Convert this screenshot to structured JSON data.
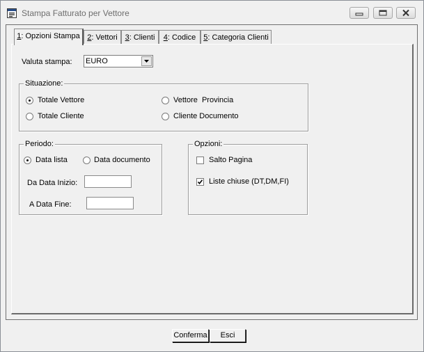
{
  "window": {
    "title": "Stampa Fatturato per Vettore",
    "icon": "form-window-icon",
    "controls": [
      "minimize-icon",
      "restore-icon",
      "close-icon"
    ]
  },
  "tabs": [
    {
      "mnemonic": "1",
      "label": ": Opzioni Stampa",
      "active": true
    },
    {
      "mnemonic": "2",
      "label": ": Vettori",
      "active": false
    },
    {
      "mnemonic": "3",
      "label": ": Clienti",
      "active": false
    },
    {
      "mnemonic": "4",
      "label": ": Codice",
      "active": false
    },
    {
      "mnemonic": "5",
      "label": ": Categoria Clienti",
      "active": false
    }
  ],
  "valuta": {
    "label": "Valuta stampa:",
    "value": "EURO"
  },
  "situazione": {
    "legend": "Situazione:",
    "options": [
      {
        "label": "Totale Vettore",
        "selected": true
      },
      {
        "label": "Totale Cliente",
        "selected": false
      },
      {
        "label": "Vettore  Provincia",
        "selected": false
      },
      {
        "label": "Cliente Documento",
        "selected": false
      }
    ]
  },
  "periodo": {
    "legend": "Periodo:",
    "options": [
      {
        "label": "Data lista",
        "selected": true
      },
      {
        "label": "Data documento",
        "selected": false
      }
    ],
    "da_label": "Da Data Inizio:",
    "da_value": "",
    "a_label": "A Data Fine:",
    "a_value": ""
  },
  "opzioni": {
    "legend": "Opzioni:",
    "items": [
      {
        "label": "Salto Pagina",
        "checked": false
      },
      {
        "label": "Liste chiuse (DT,DM,FI)",
        "checked": true
      }
    ]
  },
  "buttons": {
    "conferma": "Conferma",
    "esci": "Esci"
  }
}
